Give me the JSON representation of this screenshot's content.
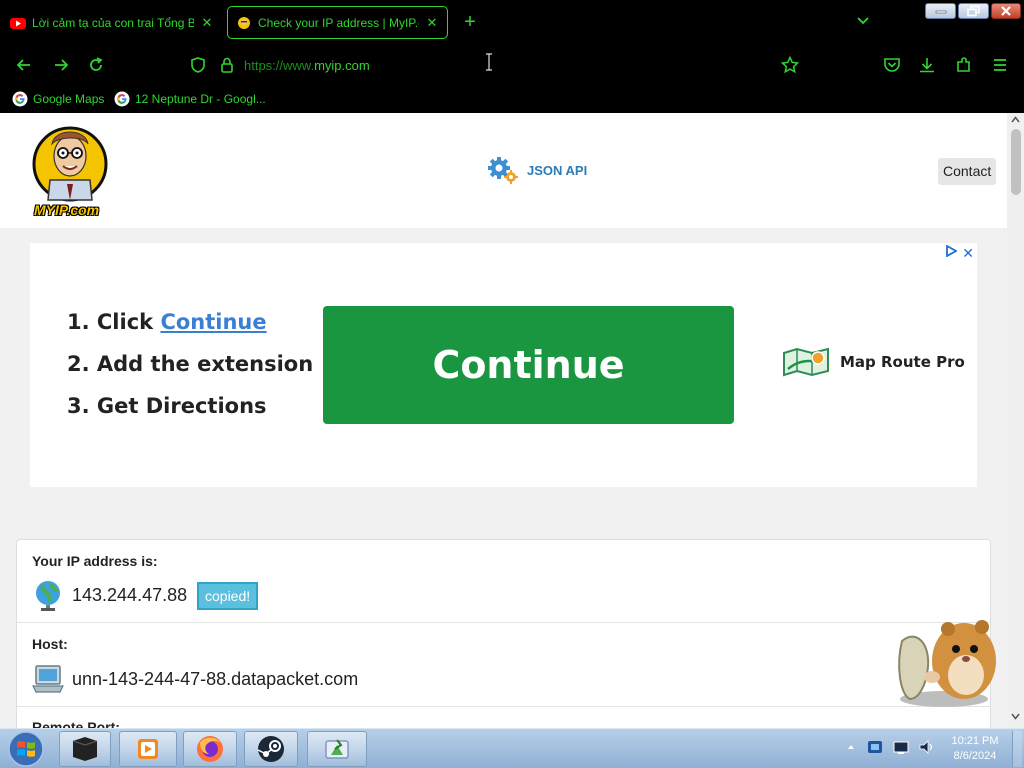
{
  "browser": {
    "tabs": [
      {
        "title": "Lời cảm tạ của con trai Tổng Bí thư",
        "icon": "youtube-icon",
        "active": false
      },
      {
        "title": "Check your IP address | MyIP.com",
        "icon": "myip-favicon",
        "active": true
      }
    ],
    "url_prefix": "https://www.",
    "url_domain": "myip.com",
    "bookmarks": [
      {
        "label": "Google Maps",
        "icon": "google-icon"
      },
      {
        "label": "12 Neptune Dr - Googl...",
        "icon": "google-icon"
      }
    ]
  },
  "site": {
    "logo_text": "MYIP.com",
    "nav_json_api": "JSON API",
    "nav_contact": "Contact"
  },
  "ad": {
    "step1_prefix": "1. Click",
    "step1_link": "Continue",
    "step2": "2. Add the extension",
    "step3": "3. Get Directions",
    "cta": "Continue",
    "brand": "Map Route Pro"
  },
  "ip_info": {
    "ip_heading": "Your IP address is:",
    "ip_value": "143.244.47.88",
    "copied_label": "copied!",
    "host_heading": "Host:",
    "host_value": "unn-143-244-47-88.datapacket.com",
    "port_heading": "Remote Port:"
  },
  "taskbar": {
    "time": "10:21 PM",
    "date": "8/6/2024"
  },
  "colors": {
    "browser_chrome": "#000000",
    "browser_accent": "#2fd62f",
    "cta_green": "#1a9641",
    "link_blue": "#3b7fd4",
    "copied_badge": "#5bc0de"
  }
}
